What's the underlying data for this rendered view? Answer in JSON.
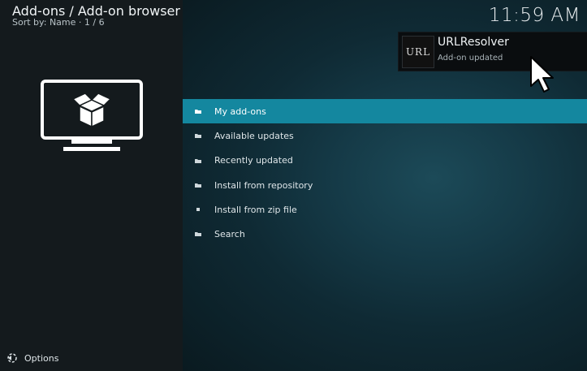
{
  "header": {
    "title": "Add-ons / Add-on browser",
    "subtitle": "Sort by: Name  ·  1 / 6"
  },
  "clock": "11:59 AM",
  "notification": {
    "thumb_text": "URL",
    "title": "URLResolver",
    "message": "Add-on updated"
  },
  "menu": {
    "items": [
      {
        "label": "My add-ons",
        "icon": "folder-icon"
      },
      {
        "label": "Available updates",
        "icon": "folder-icon"
      },
      {
        "label": "Recently updated",
        "icon": "folder-icon"
      },
      {
        "label": "Install from repository",
        "icon": "folder-icon"
      },
      {
        "label": "Install from zip file",
        "icon": "file-icon"
      },
      {
        "label": "Search",
        "icon": "folder-icon"
      }
    ],
    "selected_index": 0
  },
  "footer": {
    "options_label": "Options"
  },
  "colors": {
    "accent": "#14879f",
    "background": "#0b1418",
    "sidebar": "#141a1d"
  }
}
